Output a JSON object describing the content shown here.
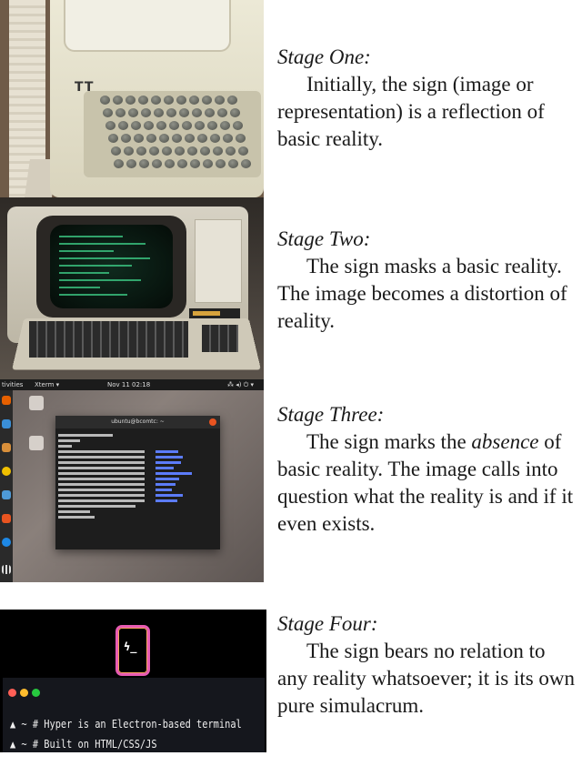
{
  "stages": [
    {
      "title": "Stage One:",
      "text": "Initially, the sign (image or representation) is a reflection of basic reality."
    },
    {
      "title": "Stage Two:",
      "text": "The sign masks a basic reality. The image becomes a distortion of reality."
    },
    {
      "title": "Stage Three:",
      "text_before": "The sign marks the ",
      "text_emphasis": "absence",
      "text_after": " of basic reality. The image calls into question what the reality is and if it even exists."
    },
    {
      "title": "Stage Four:",
      "text": "The sign bears no relation to any reality whatsoever; it is its own pure simulacrum."
    }
  ],
  "panel1": {
    "logo": "TT"
  },
  "panel3": {
    "activities": "tivities",
    "app": "Xterm ▾",
    "clock": "Nov 11 02:18",
    "tray": "⁂ ◂) ⏻ ▾",
    "window_title": "ubuntu@bcomtc: ~"
  },
  "panel4": {
    "logo_text": "ϟ_",
    "lines": [
      "▲ ~ # Hyper is an Electron-based terminal",
      "▲ ~ # Built on HTML/CSS/JS"
    ],
    "colors": {
      "close": "#ff5f56",
      "minimize": "#ffbd2e",
      "maximize": "#27c93f"
    }
  }
}
